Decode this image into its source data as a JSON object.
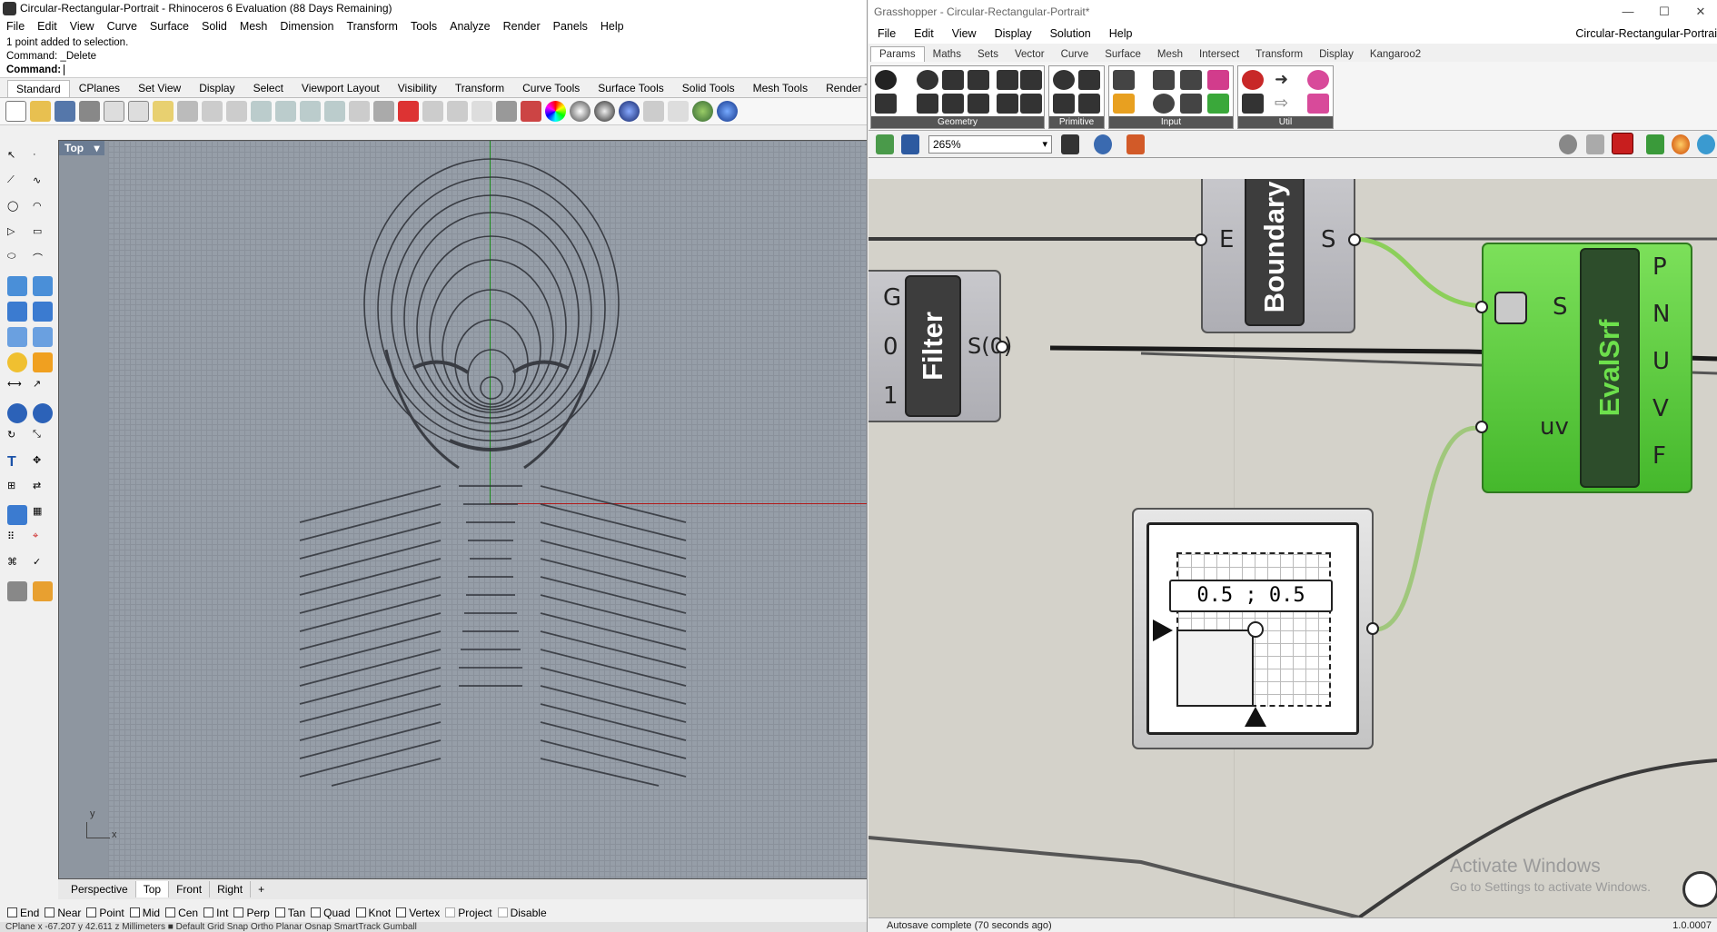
{
  "rhino": {
    "title": "Circular-Rectangular-Portrait - Rhinoceros 6 Evaluation (88 Days Remaining)",
    "menu": [
      "File",
      "Edit",
      "View",
      "Curve",
      "Surface",
      "Solid",
      "Mesh",
      "Dimension",
      "Transform",
      "Tools",
      "Analyze",
      "Render",
      "Panels",
      "Help"
    ],
    "history": [
      "1 point added to selection.",
      "Command: _Delete"
    ],
    "command_label": "Command:",
    "command_value": "",
    "toolbar_tabs": [
      "Standard",
      "CPlanes",
      "Set View",
      "Display",
      "Select",
      "Viewport Layout",
      "Visibility",
      "Transform",
      "Curve Tools",
      "Surface Tools",
      "Solid Tools",
      "Mesh Tools",
      "Render Too"
    ],
    "active_tab": "Standard",
    "viewport_label": "Top",
    "axis_labels": {
      "y": "y",
      "x": "x"
    },
    "viewport_tabs": [
      "Perspective",
      "Top",
      "Front",
      "Right"
    ],
    "viewport_add": "+",
    "osnaps": [
      "End",
      "Near",
      "Point",
      "Mid",
      "Cen",
      "Int",
      "Perp",
      "Tan",
      "Quad",
      "Knot",
      "Vertex",
      "Project",
      "Disable"
    ],
    "status_bar": "CPlane   x -67.207   y 42.611   z          Millimeters   ■ Default          Grid Snap   Ortho   Planar   Osnap   SmartTrack   Gumball"
  },
  "grasshopper": {
    "title": "Grasshopper - Circular-Rectangular-Portrait*",
    "window_controls": [
      "—",
      "☐",
      "✕"
    ],
    "menu": [
      "File",
      "Edit",
      "View",
      "Display",
      "Solution",
      "Help"
    ],
    "doc_title": "Circular-Rectangular-Portrai",
    "tabs": [
      "Params",
      "Maths",
      "Sets",
      "Vector",
      "Curve",
      "Surface",
      "Mesh",
      "Intersect",
      "Transform",
      "Display",
      "Kangaroo2"
    ],
    "active_tab": "Params",
    "ribbon_groups": [
      "Geometry",
      "Primitive",
      "Input",
      "Util"
    ],
    "zoom": "265%",
    "status": "Autosave complete (70 seconds ago)",
    "version": "1.0.0007",
    "components": {
      "filter": {
        "name": "Filter",
        "inputs": [
          "G",
          "0",
          "1"
        ],
        "output": "S(0)"
      },
      "boundary": {
        "name": "Boundary",
        "input": "E",
        "output": "S"
      },
      "evalsrf": {
        "name": "EvalSrf",
        "inputs": [
          "S",
          "uv"
        ],
        "outputs": [
          "P",
          "N",
          "U",
          "V",
          "F"
        ]
      },
      "mdslider": {
        "value": "0.5 ; 0.5"
      }
    },
    "watermark": {
      "line1": "Activate Windows",
      "line2": "Go to Settings to activate Windows."
    }
  },
  "colors": {
    "viewport_bg": "#969ea8",
    "gh_canvas": "#d4d2ca",
    "component_green": "#5ac93c",
    "wire_green": "#8ccf5a",
    "axis_x": "#b21818",
    "axis_y": "#1a8a1a"
  }
}
